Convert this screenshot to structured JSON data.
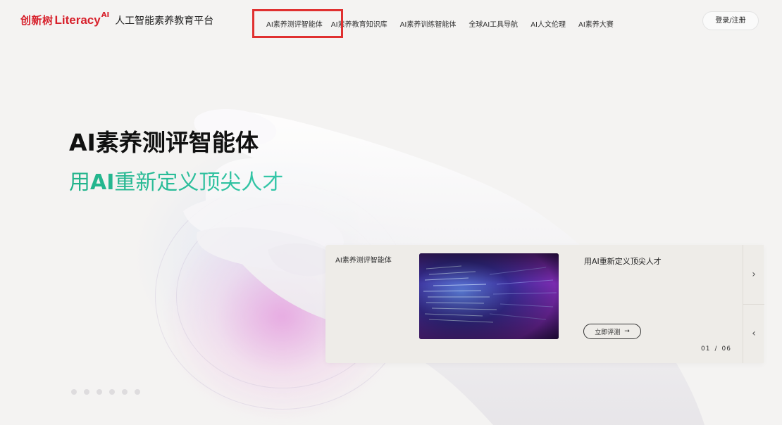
{
  "brand": {
    "cn": "创新树",
    "en": "Literacy",
    "ai": "AI",
    "title": "人工智能素养教育平台"
  },
  "nav": {
    "items": [
      {
        "label": "AI素养测评智能体"
      },
      {
        "label": "AI素养教育知识库"
      },
      {
        "label": "AI素养训练智能体"
      },
      {
        "label": "全球AI工具导航"
      },
      {
        "label": "AI人文伦理"
      },
      {
        "label": "AI素养大赛"
      }
    ]
  },
  "login": {
    "label": "登录/注册"
  },
  "hero": {
    "title": "AI素养测评智能体",
    "subtitle_prefix": "用",
    "subtitle_bold": "AI",
    "subtitle_rest": "重新定义顶尖人才"
  },
  "card": {
    "label": "AI素养测评智能体",
    "description": "用AI重新定义顶尖人才",
    "button_label": "立即评测",
    "button_icon": "→",
    "page_current": "01",
    "page_sep": "/",
    "page_total": "06",
    "next_icon": "›",
    "prev_icon": "‹"
  },
  "colors": {
    "brand_red": "#d7202b",
    "subtitle_green": "#1fb891",
    "highlight_red": "#e03030"
  },
  "dots_count": 6
}
